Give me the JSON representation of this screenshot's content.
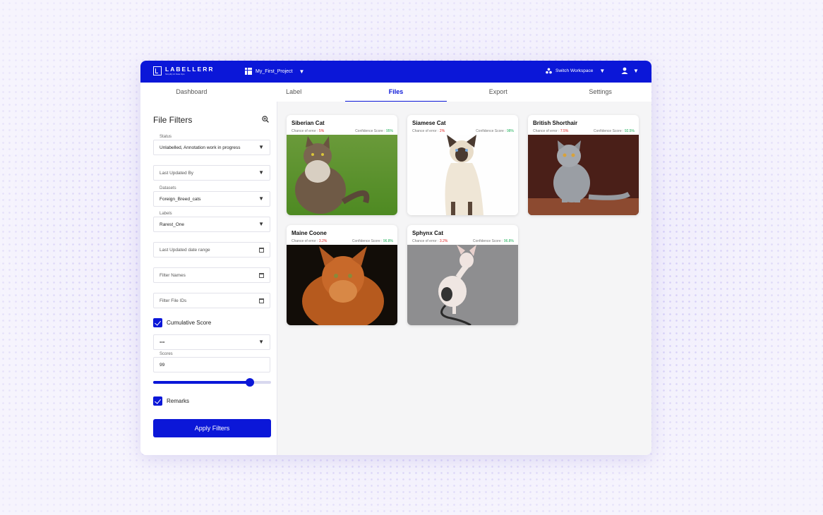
{
  "header": {
    "logo_name": "LABELLERR",
    "logo_tagline": "Simplify AI Data Ops",
    "project_name": "My_First_Project",
    "workspace_label": "Switch Workspace"
  },
  "tabs": [
    {
      "label": "Dashboard"
    },
    {
      "label": "Label"
    },
    {
      "label": "Files",
      "active": true
    },
    {
      "label": "Export"
    },
    {
      "label": "Settings"
    }
  ],
  "filters": {
    "title": "File Filters",
    "status": {
      "label": "Status",
      "value": "Unlabelled, Annotation work in progress"
    },
    "last_updated_by": {
      "placeholder": "Last Updated By"
    },
    "datasets": {
      "label": "Datasets",
      "value": "Foreign_Breed_cats"
    },
    "labels": {
      "label": "Labels",
      "value": "Rarest_One"
    },
    "date_range": {
      "placeholder": "Last Updated date range"
    },
    "filter_names": {
      "placeholder": "Filter Names"
    },
    "filter_file_ids": {
      "placeholder": "Filter File IDs"
    },
    "cumulative_score": {
      "label": "Cumulative Score",
      "checked": true
    },
    "operator": {
      "value": "=="
    },
    "scores": {
      "label": "Scores",
      "value": "99"
    },
    "slider": {
      "fraction": 0.82
    },
    "remarks": {
      "label": "Remarks",
      "checked": true
    },
    "apply_label": "Apply Filters"
  },
  "cards": [
    {
      "name": "Siberian Cat",
      "error_label": "Chance of error :",
      "error_value": "5%",
      "confidence_label": "Confidence Score :",
      "confidence_value": "95%"
    },
    {
      "name": "Siamese Cat",
      "error_label": "Chance of error :",
      "error_value": "2%",
      "confidence_label": "Confidence Score :",
      "confidence_value": "98%"
    },
    {
      "name": "British Shorthair",
      "error_label": "Chance of error :",
      "error_value": "7.5%",
      "confidence_label": "Confidence Score :",
      "confidence_value": "92.5%"
    },
    {
      "name": "Maine Coone",
      "error_label": "Chance of error :",
      "error_value": "3.2%",
      "confidence_label": "Confidence Score :",
      "confidence_value": "96.8%"
    },
    {
      "name": "Sphynx Cat",
      "error_label": "Chance of error :",
      "error_value": "3.2%",
      "confidence_label": "Confidence Score :",
      "confidence_value": "96.8%"
    }
  ],
  "colors": {
    "accent": "#0b17d8",
    "error": "#e02424",
    "confidence": "#1fb15a"
  }
}
